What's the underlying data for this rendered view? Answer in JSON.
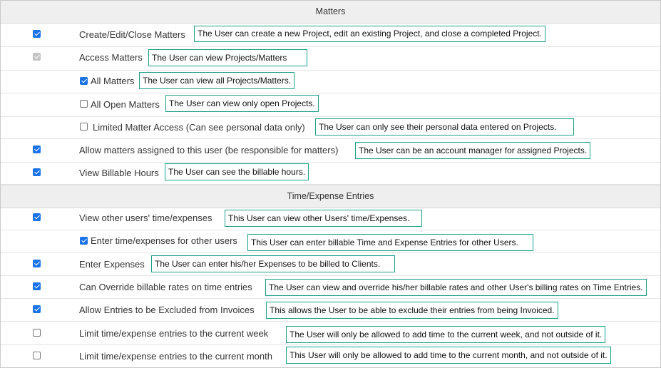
{
  "sections": {
    "matters": {
      "title": "Matters"
    },
    "time_expense": {
      "title": "Time/Expense Entries"
    }
  },
  "colors": {
    "checkbox": "#1a73e8",
    "annotation_border": "#1b9e8a",
    "header_bg": "#efefef"
  },
  "rows": [
    {
      "label": "Create/Edit/Close Matters",
      "note": "The User can create a new Project, edit an existing Project, and close a completed Project.",
      "checked": true,
      "disabled": false
    },
    {
      "label": "Access Matters",
      "note": "The User can view Projects/Matters",
      "checked": true,
      "disabled": true
    },
    {
      "label": "All Matters",
      "note": "The User can view all Projects/Matters.",
      "checked": true,
      "disabled": false
    },
    {
      "label": "All Open Matters",
      "note": "The User can view only open Projects.",
      "checked": false,
      "disabled": false
    },
    {
      "label": "Limited Matter Access (Can see personal data only)",
      "note": "The User can only see their personal data entered on Projects.",
      "checked": false,
      "disabled": false
    },
    {
      "label": "Allow matters assigned to this user (be responsible for matters)",
      "note": "The User can be an account manager for assigned Projects.",
      "checked": true,
      "disabled": false
    },
    {
      "label": "View Billable Hours",
      "note": "The User can see the billable hours.",
      "checked": true,
      "disabled": false
    },
    {
      "label": "View other users' time/expenses",
      "note": "This User can view other Users' time/Expenses.",
      "checked": true,
      "disabled": false
    },
    {
      "label": "Enter time/expenses for other users",
      "note": "This User can enter billable Time and Expense Entries for other Users.",
      "checked": true,
      "disabled": false
    },
    {
      "label": "Enter Expenses",
      "note": "The User can enter his/her Expenses to be billed to Clients.",
      "checked": true,
      "disabled": false
    },
    {
      "label": "Can Override billable rates on time entries",
      "note": "The User can view and override his/her billable rates and other User's billing rates on Time Entries.",
      "checked": true,
      "disabled": false
    },
    {
      "label": "Allow Entries to be Excluded from Invoices",
      "note": "This allows the User to be able to exclude their entries from being Invoiced.",
      "checked": true,
      "disabled": false
    },
    {
      "label": "Limit time/expense entries to the current week",
      "note": "The User will only be allowed to add time to the current week, and not outside of it.",
      "checked": false,
      "disabled": false
    },
    {
      "label": "Limit time/expense entries to the current month",
      "note": "This User will only be allowed to add time to the current month, and not outside of it.",
      "checked": false,
      "disabled": false
    }
  ]
}
